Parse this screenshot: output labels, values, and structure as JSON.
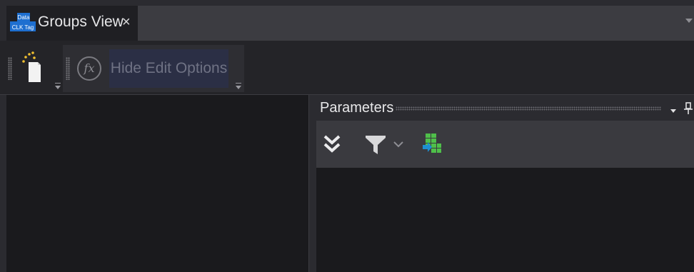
{
  "tab": {
    "title": "Groups View",
    "close_glyph": "×",
    "icon": {
      "name": "data-clk-tag-icon",
      "lines": [
        "Data",
        "CLK Tag"
      ]
    },
    "overflow_icon": "chevron-down-icon"
  },
  "toolbar": {
    "new_icon": "new-document-icon",
    "fx_label": "fx",
    "hide_edit_label": "Hide Edit Options"
  },
  "parameters": {
    "title": "Parameters",
    "menu_icon": "chevron-down-icon",
    "pin_icon": "pin-icon",
    "tools": [
      "collapse-all-icon",
      "filter-icon",
      "grid-export-icon"
    ]
  },
  "colors": {
    "background": "#2b2b30",
    "pane": "#1a1a1d",
    "accent_blue": "#1e6fd0",
    "accent_green": "#4fbf4a",
    "disabled_button": "#2b2f45"
  }
}
